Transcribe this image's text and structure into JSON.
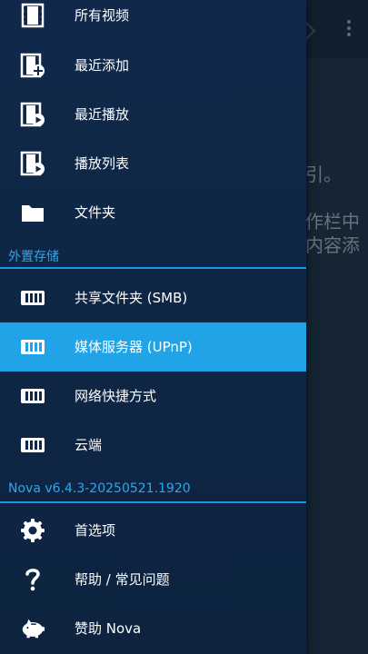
{
  "background": {
    "text_lines": [
      "引。",
      "作栏中",
      "内容添"
    ]
  },
  "drawer": {
    "items_top": [
      {
        "label": "所有视频",
        "icon": "film-icon"
      },
      {
        "label": "最近添加",
        "icon": "film-add-icon"
      },
      {
        "label": "最近播放",
        "icon": "film-play-icon"
      },
      {
        "label": "播放列表",
        "icon": "playlist-icon"
      },
      {
        "label": "文件夹",
        "icon": "folder-icon"
      }
    ],
    "section_external": "外置存储",
    "items_storage": [
      {
        "label": "共享文件夹 (SMB)",
        "icon": "nas-icon"
      },
      {
        "label": "媒体服务器 (UPnP)",
        "icon": "nas-icon",
        "active": true
      },
      {
        "label": "网络快捷方式",
        "icon": "nas-icon"
      },
      {
        "label": "云端",
        "icon": "nas-icon"
      }
    ],
    "section_version": "Nova v6.4.3-20250521.1920",
    "items_bottom": [
      {
        "label": "首选项",
        "icon": "gear-icon"
      },
      {
        "label": "帮助 / 常见问题",
        "icon": "question-icon"
      },
      {
        "label": "赞助 Nova",
        "icon": "piggy-bank-icon"
      }
    ]
  },
  "colors": {
    "drawer_bg": "#10294a",
    "accent": "#21a3e8",
    "section_text": "#2aa8ee"
  }
}
